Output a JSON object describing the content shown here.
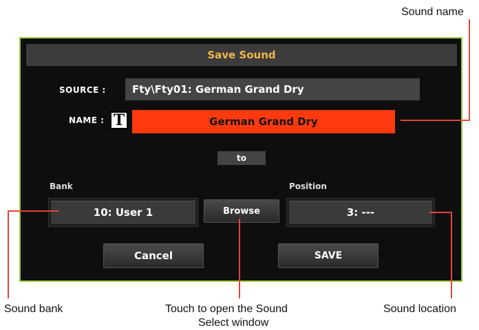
{
  "dialog": {
    "title": "Save Sound",
    "source_label": "SOURCE :",
    "source_value": "Fty\\Fty01: German Grand Dry",
    "name_label": "NAME :",
    "text_edit_icon": "T",
    "name_value": "German Grand Dry",
    "to_label": "to",
    "bank_label": "Bank",
    "bank_value": "10: User 1",
    "browse_label": "Browse",
    "position_label": "Position",
    "position_value": "3: ---",
    "cancel_label": "Cancel",
    "save_label": "SAVE"
  },
  "callouts": {
    "sound_name": "Sound name",
    "sound_bank": "Sound bank",
    "touch_select_line1": "Touch to open the Sound",
    "touch_select_line2": "Select window",
    "sound_location": "Sound location"
  },
  "colors": {
    "accent_title": "#f2b84b",
    "name_field": "#ff3a0f",
    "dialog_border": "#9ecb3a",
    "callout_line": "#e2463a"
  }
}
